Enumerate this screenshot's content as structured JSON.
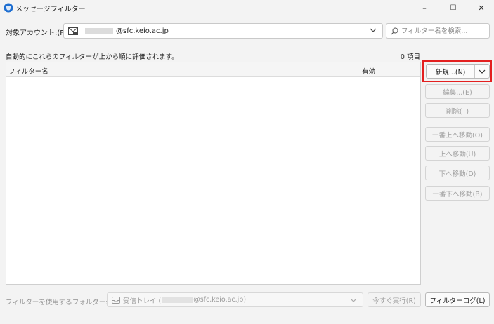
{
  "window": {
    "title": "メッセージフィルター",
    "minimize": "–",
    "maximize": "☐",
    "close": "✕"
  },
  "account": {
    "label": "対象アカウント:(F)",
    "value": "@sfc.keio.ac.jp"
  },
  "search": {
    "placeholder": "フィルター名を検索..."
  },
  "description": "自動的にこれらのフィルターが上から順に評価されます。",
  "item_count": "0 項目",
  "list": {
    "columns": [
      "フィルター名",
      "有効"
    ],
    "rows": []
  },
  "buttons": {
    "new": "新規...(N)",
    "edit": "編集...(E)",
    "delete": "削除(T)",
    "move_top": "一番上へ移動(O)",
    "move_up": "上へ移動(U)",
    "move_down": "下へ移動(D)",
    "move_bottom": "一番下へ移動(B)",
    "run_now": "今すぐ実行(R)",
    "filter_log": "フィルターログ(L)"
  },
  "folder": {
    "label": "フィルターを使用するフォルダー:(C)",
    "value_prefix": "受信トレイ (",
    "value_suffix": "@sfc.keio.ac.jp)"
  },
  "colors": {
    "highlight": "#e32020",
    "app_icon": "#1f6fd1"
  }
}
